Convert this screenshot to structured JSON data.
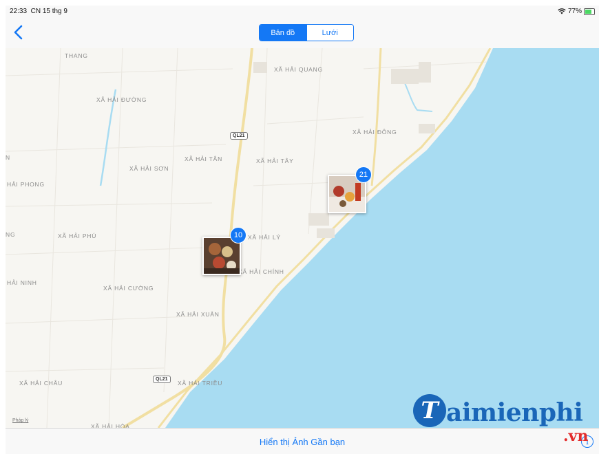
{
  "status": {
    "time": "22:33",
    "date": "CN 15 thg 9",
    "battery": "77%"
  },
  "nav": {
    "segments": [
      "Bản đồ",
      "Lưới"
    ],
    "selected": "Bản đồ"
  },
  "map": {
    "places": [
      "THANG",
      "XÃ HẢI QUANG",
      "XÃ HẢI ĐƯỜNG",
      "XÃ HẢI ĐÔNG",
      "XÃ HẢI TÂN",
      "XÃ HẢI TÂY",
      "XÃ HẢI SƠN",
      "HẢI PHONG",
      "N",
      "NG",
      "XÃ HẢI PHÚ",
      "XÃ HẢI LÝ",
      "XÃ HẢI CHÍNH",
      "HẢI NINH",
      "XÃ HẢI CƯỜNG",
      "XÃ HẢI XUÂN",
      "XÃ HẢI CHÂU",
      "XÃ HẢI TRIỀU",
      "XÃ HẢI HÒA"
    ],
    "road_shields": [
      "QL21",
      "QL21"
    ],
    "pins": [
      {
        "count": "21"
      },
      {
        "count": "10"
      }
    ],
    "legal": "Pháp lý",
    "colors": {
      "sea": "#a8dcf2",
      "land": "#f7f6f2",
      "road": "#f1dfa2",
      "accent": "#1478f5"
    }
  },
  "bottom": {
    "link": "Hiển thị Ảnh Gần bạn"
  },
  "watermark": {
    "brand": "aimienphi",
    "initial": "T",
    "tld": ".vn"
  },
  "icons": {
    "back": "chevron-left-icon",
    "info": "info-icon",
    "wifi": "wifi-icon",
    "battery": "battery-icon"
  }
}
